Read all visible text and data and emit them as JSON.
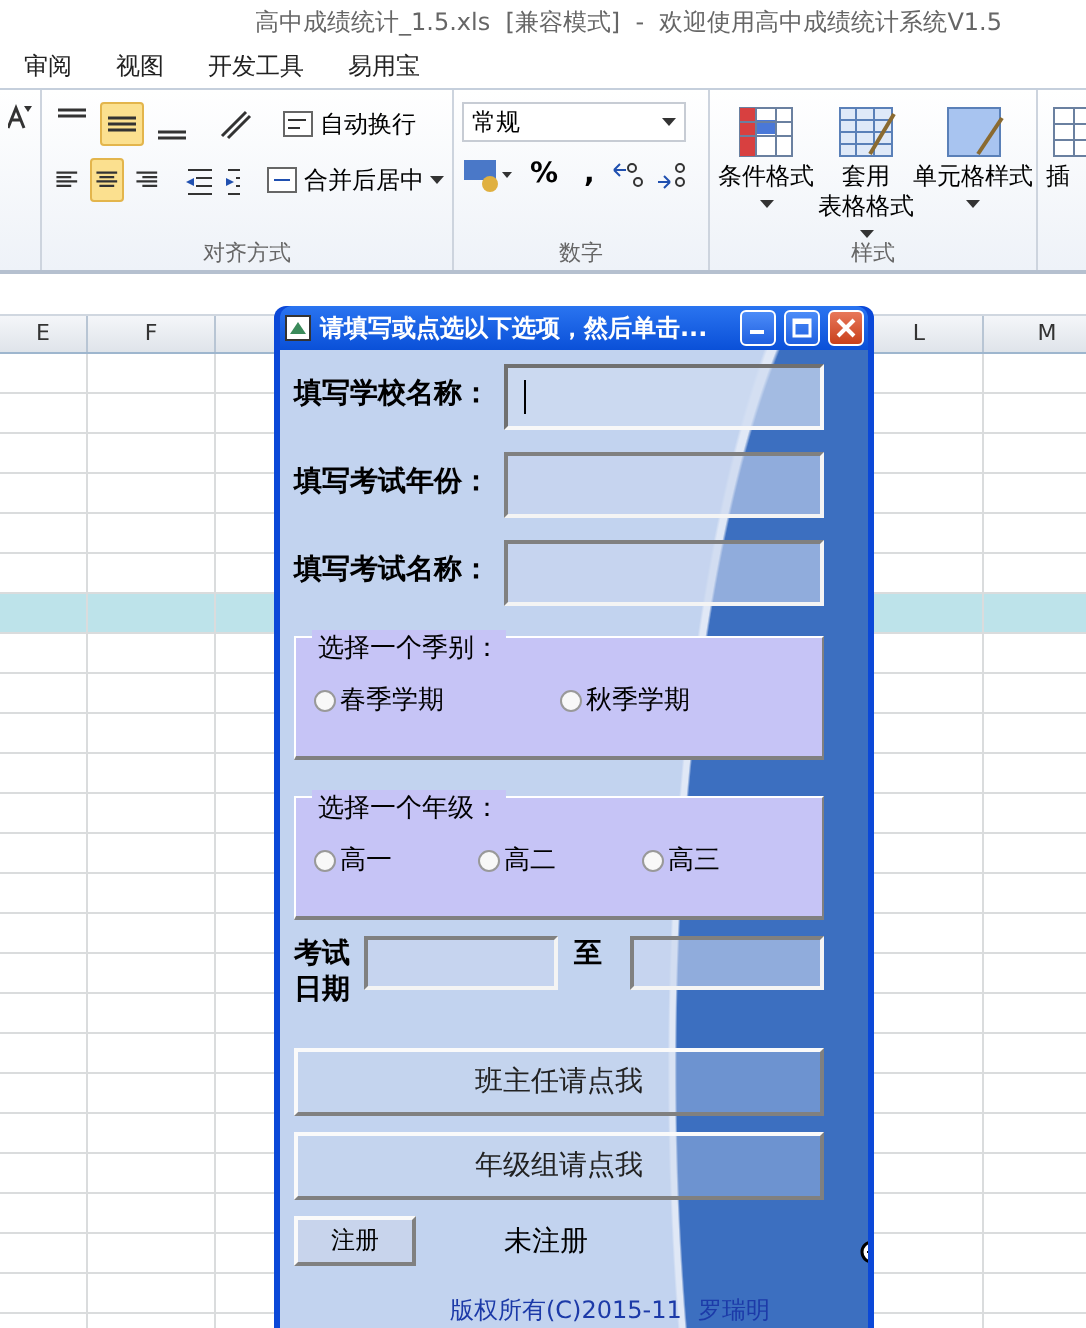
{
  "window": {
    "title": "高中成绩统计_1.5.xls  [兼容模式]  -  欢迎使用高中成绩统计系统V1.5"
  },
  "menu_tabs": [
    {
      "label": "审阅"
    },
    {
      "label": "视图"
    },
    {
      "label": "开发工具"
    },
    {
      "label": "易用宝"
    }
  ],
  "alignment_group": {
    "label": "对齐方式",
    "top_row": [
      {
        "kind": "top",
        "selected": false
      },
      {
        "kind": "middle",
        "selected": true
      },
      {
        "kind": "bottom",
        "selected": false
      }
    ],
    "bottom_row": [
      {
        "kind": "left",
        "selected": false
      },
      {
        "kind": "center",
        "selected": true
      },
      {
        "kind": "right",
        "selected": false
      }
    ],
    "wrap_text": "自动换行",
    "merge_center": "合并后居中"
  },
  "number_group": {
    "label": "数字",
    "format": "常规",
    "percent": "%",
    "comma": ","
  },
  "styles_group": {
    "label": "样式",
    "buttons": [
      {
        "kind": "conditional",
        "lines": [
          "条件格式"
        ]
      },
      {
        "kind": "table",
        "lines": [
          "套用",
          "表格格式"
        ]
      },
      {
        "kind": "cell",
        "lines": [
          "单元格样式"
        ]
      }
    ]
  },
  "cells_group": {
    "button": "插"
  },
  "sheet": {
    "columns": [
      "E",
      "F",
      "L",
      "M"
    ],
    "rows": [
      {
        "selected": false
      },
      {
        "selected": false
      },
      {
        "selected": false
      },
      {
        "selected": false
      },
      {
        "selected": false
      },
      {
        "selected": false
      },
      {
        "selected": true
      },
      {
        "selected": false
      },
      {
        "selected": false
      },
      {
        "selected": false
      },
      {
        "selected": false
      },
      {
        "selected": false
      },
      {
        "selected": false
      },
      {
        "selected": false
      },
      {
        "selected": false
      },
      {
        "selected": false
      },
      {
        "selected": false
      },
      {
        "selected": false
      },
      {
        "selected": false
      },
      {
        "selected": false
      },
      {
        "selected": false
      },
      {
        "selected": false
      },
      {
        "selected": false
      },
      {
        "selected": false
      },
      {
        "selected": false
      }
    ]
  },
  "dialog": {
    "title": "请填写或点选以下选项，然后单击...",
    "fields": [
      {
        "label": "填写学校名称：",
        "focused": true
      },
      {
        "label": "填写考试年份：",
        "focused": false
      },
      {
        "label": "填写考试名称：",
        "focused": false
      }
    ],
    "season_group": {
      "legend": "选择一个季别：",
      "options": [
        {
          "label": "春季学期",
          "selected": false
        },
        {
          "label": "秋季学期",
          "selected": false
        }
      ]
    },
    "grade_group": {
      "legend": "选择一个年级：",
      "options": [
        {
          "label": "高一",
          "selected": false
        },
        {
          "label": "高二",
          "selected": false
        },
        {
          "label": "高三",
          "selected": false
        }
      ]
    },
    "date": {
      "label": "考试日期",
      "to": "至"
    },
    "buttons": [
      "班主任请点我",
      "年级组请点我"
    ],
    "register_button": "注册",
    "status": "未注册",
    "copyright": "版权所有(C)2015-11",
    "author": "罗瑞明"
  }
}
